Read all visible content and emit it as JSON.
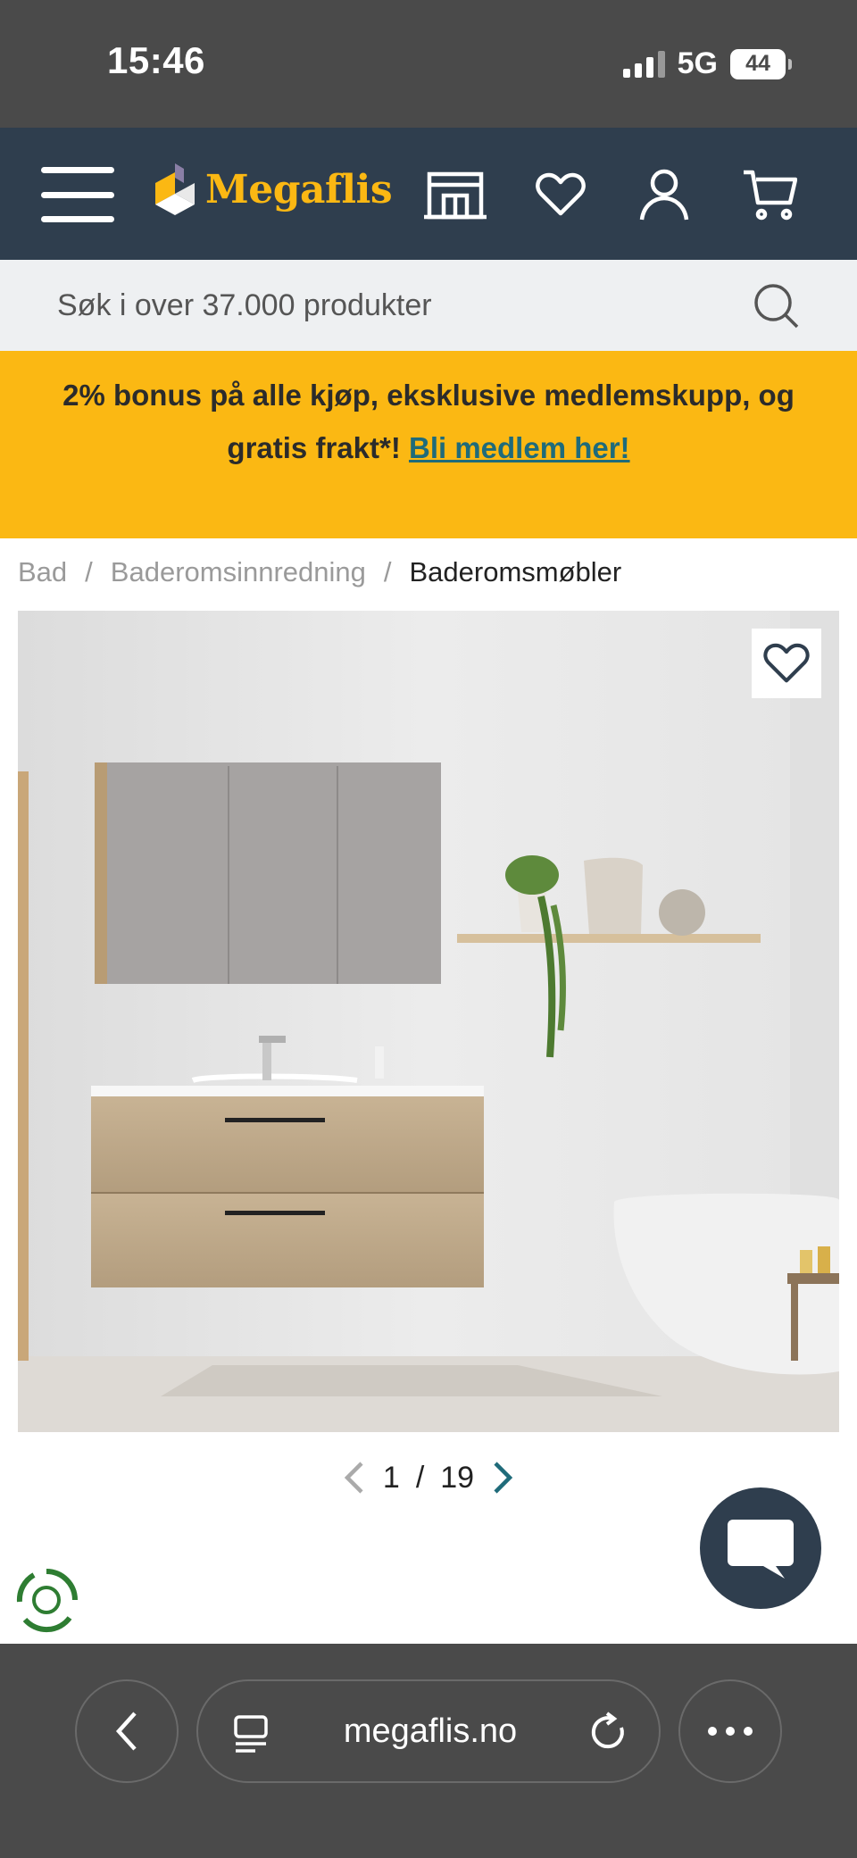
{
  "status_bar": {
    "time": "15:46",
    "network": "5G",
    "battery": "44"
  },
  "header": {
    "brand": "Megaflis"
  },
  "search": {
    "placeholder": "Søk i over 37.000 produkter"
  },
  "banner": {
    "text": "2% bonus på alle kjøp, eksklusive medlemskupp, og gratis frakt*!",
    "link_label": "Bli medlem her!"
  },
  "breadcrumb": {
    "items": [
      "Bad",
      "Baderomsinnredning",
      "Baderomsmøbler"
    ],
    "separator": "/"
  },
  "gallery": {
    "current": "1",
    "separator": "/",
    "total": "19"
  },
  "browser": {
    "url": "megaflis.no"
  },
  "colors": {
    "header_bg": "#2f3e4e",
    "accent_yellow": "#fbb813",
    "link_teal": "#1f6b7a"
  }
}
